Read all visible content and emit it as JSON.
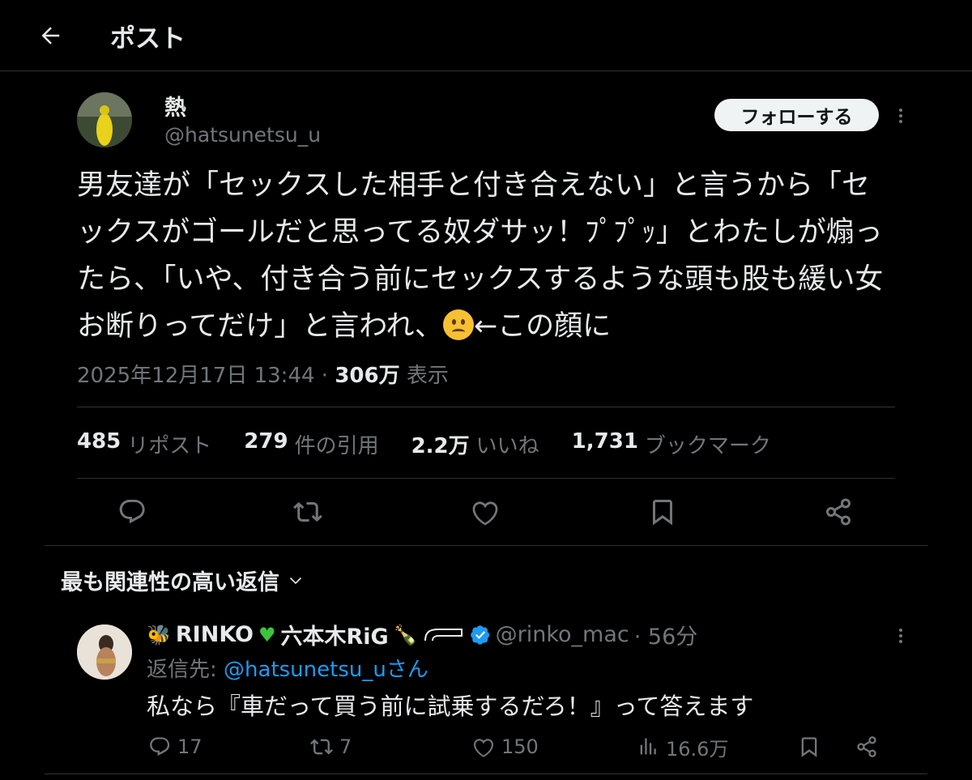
{
  "header": {
    "title": "ポスト"
  },
  "post": {
    "author_name": "熱",
    "author_handle": "@hatsunetsu_u",
    "follow_label": "フォローする",
    "text_part1": "男友達が「セックスした相手と付き合えない」と言うから「セックスがゴールだと思ってる奴ダサッ！ﾌﾟﾌﾟｯ」とわたしが煽ったら、「いや、付き合う前にセックスするような頭も股も緩い女お断りってだけ」と言われ、",
    "text_part2": "←この顔に",
    "emoji_name": "slightly-frowning-face",
    "date": "2025年12月17日 13:44 · ",
    "views": "306万",
    "views_label": " 表示"
  },
  "stats": [
    {
      "count": "485",
      "label": "リポスト"
    },
    {
      "count": "279",
      "label": "件の引用"
    },
    {
      "count": "2.2万",
      "label": "いいね"
    },
    {
      "count": "1,731",
      "label": "ブックマーク"
    }
  ],
  "icons": {
    "reply": "reply-icon",
    "repost": "repost-icon",
    "like": "heart-icon",
    "bookmark": "bookmark-icon",
    "share": "share-icon",
    "views": "views-icon",
    "back": "back-arrow-icon"
  },
  "replies_section": {
    "sort_label": "最も関連性の高い返信"
  },
  "reply": {
    "name_text1": "RINKO",
    "name_text2": "六本木RiG",
    "handle": "@rinko_mac",
    "time": " · 56分",
    "reply_to_prefix": "返信先: ",
    "reply_to_mention": "@hatsunetsu_uさん",
    "text": "私なら『車だって買う前に試乗するだろ！』って答えます",
    "replies": "17",
    "reposts": "7",
    "likes": "150",
    "views": "16.6万"
  },
  "colors": {
    "background": "#000000",
    "text": "#e7e9ea",
    "muted": "#71767b",
    "link": "#1d9bf0",
    "divider": "#2f3336"
  }
}
